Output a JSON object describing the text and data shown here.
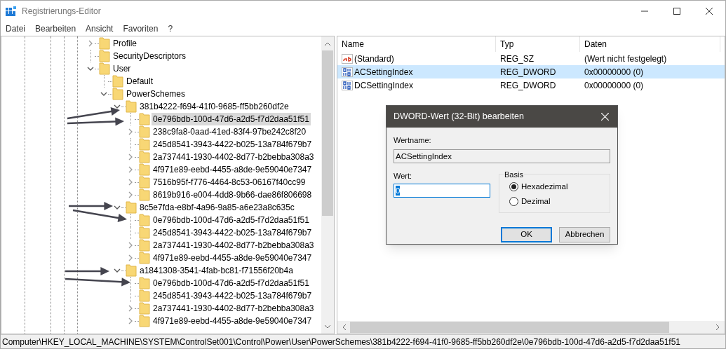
{
  "window": {
    "title": "Registrierungs-Editor"
  },
  "menu": [
    "Datei",
    "Bearbeiten",
    "Ansicht",
    "Favoriten",
    "?"
  ],
  "tree": [
    {
      "label": "Profile",
      "expandable": true,
      "expanded": false,
      "selected": false
    },
    {
      "label": "SecurityDescriptors",
      "expandable": false,
      "selected": false
    },
    {
      "label": "User",
      "expandable": true,
      "expanded": true,
      "selected": false,
      "children": [
        {
          "label": "Default",
          "expandable": false,
          "selected": false
        },
        {
          "label": "PowerSchemes",
          "expandable": true,
          "expanded": true,
          "selected": false,
          "children": [
            {
              "label": "381b4222-f694-41f0-9685-ff5bb260df2e",
              "expandable": true,
              "expanded": true,
              "selected": false,
              "children": [
                {
                  "label": "0e796bdb-100d-47d6-a2d5-f7d2daa51f51",
                  "expandable": false,
                  "selected": true
                },
                {
                  "label": "238c9fa8-0aad-41ed-83f4-97be242c8f20",
                  "expandable": true,
                  "expanded": false,
                  "selected": false
                },
                {
                  "label": "245d8541-3943-4422-b025-13a784f679b7",
                  "expandable": false,
                  "selected": false
                },
                {
                  "label": "2a737441-1930-4402-8d77-b2bebba308a3",
                  "expandable": true,
                  "expanded": false,
                  "selected": false
                },
                {
                  "label": "4f971e89-eebd-4455-a8de-9e59040e7347",
                  "expandable": true,
                  "expanded": false,
                  "selected": false
                },
                {
                  "label": "7516b95f-f776-4464-8c53-06167f40cc99",
                  "expandable": true,
                  "expanded": false,
                  "selected": false
                },
                {
                  "label": "8619b916-e004-4dd8-9b66-dae86f806698",
                  "expandable": true,
                  "expanded": false,
                  "selected": false
                }
              ]
            },
            {
              "label": "8c5e7fda-e8bf-4a96-9a85-a6e23a8c635c",
              "expandable": true,
              "expanded": true,
              "selected": false,
              "children": [
                {
                  "label": "0e796bdb-100d-47d6-a2d5-f7d2daa51f51",
                  "expandable": false,
                  "selected": false
                },
                {
                  "label": "245d8541-3943-4422-b025-13a784f679b7",
                  "expandable": false,
                  "selected": false
                },
                {
                  "label": "2a737441-1930-4402-8d77-b2bebba308a3",
                  "expandable": true,
                  "expanded": false,
                  "selected": false
                },
                {
                  "label": "4f971e89-eebd-4455-a8de-9e59040e7347",
                  "expandable": true,
                  "expanded": false,
                  "selected": false
                }
              ]
            },
            {
              "label": "a1841308-3541-4fab-bc81-f71556f20b4a",
              "expandable": true,
              "expanded": true,
              "selected": false,
              "children": [
                {
                  "label": "0e796bdb-100d-47d6-a2d5-f7d2daa51f51",
                  "expandable": false,
                  "selected": false
                },
                {
                  "label": "245d8541-3943-4422-b025-13a784f679b7",
                  "expandable": false,
                  "selected": false
                },
                {
                  "label": "2a737441-1930-4402-8d77-b2bebba308a3",
                  "expandable": true,
                  "expanded": false,
                  "selected": false
                },
                {
                  "label": "4f971e89-eebd-4455-a8de-9e59040e7347",
                  "expandable": true,
                  "expanded": false,
                  "selected": false
                }
              ]
            }
          ]
        }
      ]
    }
  ],
  "values": {
    "columns": [
      "Name",
      "Typ",
      "Daten"
    ],
    "rows": [
      {
        "kind": "string",
        "name": "(Standard)",
        "type": "REG_SZ",
        "data": "(Wert nicht festgelegt)",
        "selected": false
      },
      {
        "kind": "binary",
        "name": "ACSettingIndex",
        "type": "REG_DWORD",
        "data": "0x00000000 (0)",
        "selected": true
      },
      {
        "kind": "binary",
        "name": "DCSettingIndex",
        "type": "REG_DWORD",
        "data": "0x00000000 (0)",
        "selected": false
      }
    ]
  },
  "dialog": {
    "title": "DWORD-Wert (32-Bit) bearbeiten",
    "name_label": "Wertname:",
    "name_value": "ACSettingIndex",
    "value_label": "Wert:",
    "value": "0",
    "base_label": "Basis",
    "bases": [
      {
        "label": "Hexadezimal",
        "selected": true
      },
      {
        "label": "Dezimal",
        "selected": false
      }
    ],
    "buttons": [
      "OK",
      "Abbrechen"
    ]
  },
  "status_bar": "Computer\\HKEY_LOCAL_MACHINE\\SYSTEM\\ControlSet001\\Control\\Power\\User\\PowerSchemes\\381b4222-f694-41f0-9685-ff5bb260df2e\\0e796bdb-100d-47d6-a2d5-f7d2daa51f51"
}
